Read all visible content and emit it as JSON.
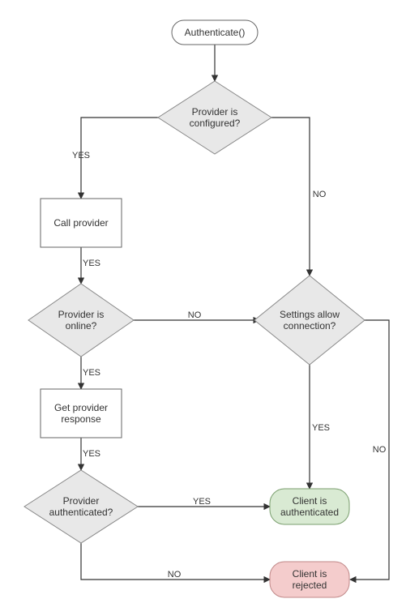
{
  "diagram": {
    "start": "Authenticate()",
    "d_configured": "Provider is\nconfigured?",
    "p_call": "Call provider",
    "d_online": "Provider is\nonline?",
    "p_response": "Get provider\nresponse",
    "d_authd": "Provider\nauthenticated?",
    "d_settings": "Settings allow\nconnection?",
    "t_auth": "Client is\nauthenticated",
    "t_rej": "Client is\nrejected"
  },
  "labels": {
    "yes": "YES",
    "no": "NO"
  }
}
